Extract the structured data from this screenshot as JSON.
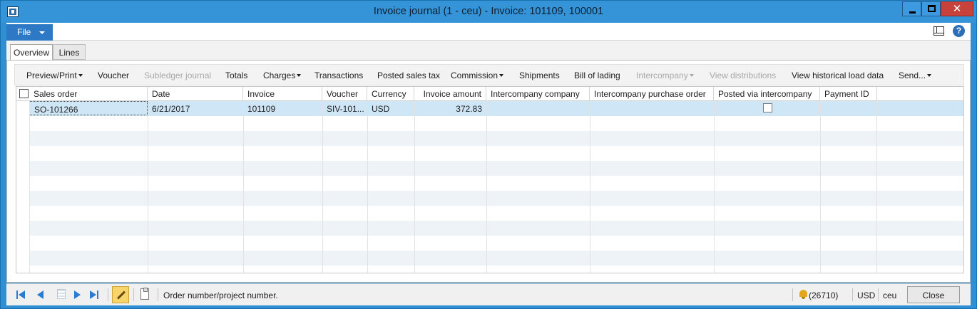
{
  "window": {
    "title": "Invoice journal (1 - ceu) - Invoice: 101109, 100001",
    "close_glyph": "✕"
  },
  "menu": {
    "file_label": "File",
    "help_glyph": "?"
  },
  "tabs": [
    {
      "label": "Overview",
      "active": true
    },
    {
      "label": "Lines",
      "active": false
    }
  ],
  "actions": [
    {
      "label": "Preview/Print",
      "dropdown": true,
      "enabled": true
    },
    {
      "label": "Voucher",
      "dropdown": false,
      "enabled": true
    },
    {
      "label": "Subledger journal",
      "dropdown": false,
      "enabled": false
    },
    {
      "label": "Totals",
      "dropdown": false,
      "enabled": true
    },
    {
      "label": "Charges",
      "dropdown": true,
      "enabled": true
    },
    {
      "label": "Transactions",
      "dropdown": false,
      "enabled": true
    },
    {
      "label": "Posted sales tax",
      "dropdown": false,
      "enabled": true
    },
    {
      "label": "Commission",
      "dropdown": true,
      "enabled": true
    },
    {
      "label": "Shipments",
      "dropdown": false,
      "enabled": true
    },
    {
      "label": "Bill of lading",
      "dropdown": false,
      "enabled": true
    },
    {
      "label": "Intercompany",
      "dropdown": true,
      "enabled": false
    },
    {
      "label": "View distributions",
      "dropdown": false,
      "enabled": false
    },
    {
      "label": "View historical load data",
      "dropdown": false,
      "enabled": true
    },
    {
      "label": "Send...",
      "dropdown": true,
      "enabled": true
    }
  ],
  "grid": {
    "columns": [
      "Sales order",
      "Date",
      "Invoice",
      "Voucher",
      "Currency",
      "Invoice amount",
      "Intercompany company",
      "Intercompany purchase order",
      "Posted via intercompany",
      "Payment ID"
    ],
    "rows": [
      {
        "sales_order": "SO-101266",
        "date": "6/21/2017",
        "invoice": "101109",
        "voucher": "SIV-101...",
        "currency": "USD",
        "invoice_amount": "372.83",
        "intercompany_company": "",
        "intercompany_purchase_order": "",
        "posted_via_intercompany": false,
        "payment_id": ""
      }
    ]
  },
  "status": {
    "message": "Order number/project number.",
    "notifications": "(26710)",
    "currency": "USD",
    "company": "ceu",
    "close_label": "Close"
  }
}
